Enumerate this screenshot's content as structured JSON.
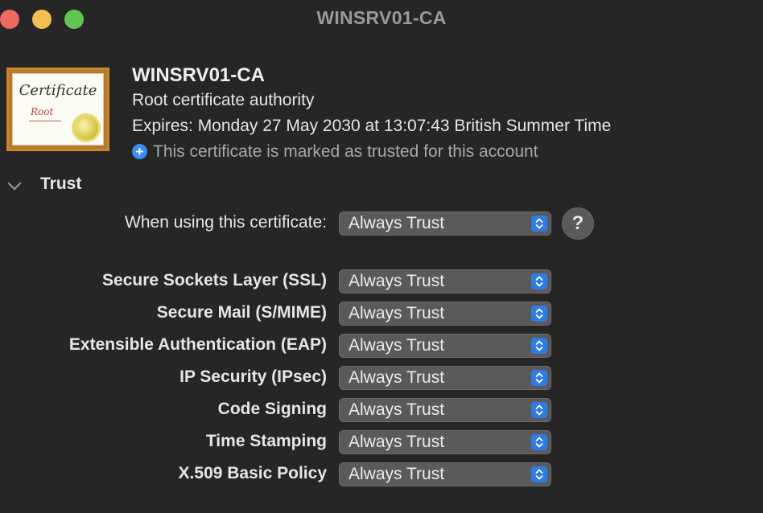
{
  "window": {
    "title": "WINSRV01-CA"
  },
  "certificate": {
    "name": "WINSRV01-CA",
    "kind": "Root certificate authority",
    "expiry": "Expires: Monday 27 May 2030 at 13:07:43 British Summer Time",
    "trust_status": "This certificate is marked as trusted for this account",
    "icon_word": "Certificate",
    "icon_sub": "Root"
  },
  "trust": {
    "section_title": "Trust",
    "when_using_label": "When using this certificate:",
    "when_using_value": "Always Trust",
    "help_label": "?",
    "rows": [
      {
        "label": "Secure Sockets Layer (SSL)",
        "value": "Always Trust"
      },
      {
        "label": "Secure Mail (S/MIME)",
        "value": "Always Trust"
      },
      {
        "label": "Extensible Authentication (EAP)",
        "value": "Always Trust"
      },
      {
        "label": "IP Security (IPsec)",
        "value": "Always Trust"
      },
      {
        "label": "Code Signing",
        "value": "Always Trust"
      },
      {
        "label": "Time Stamping",
        "value": "Always Trust"
      },
      {
        "label": "X.509 Basic Policy",
        "value": "Always Trust"
      }
    ]
  },
  "colors": {
    "accent": "#2e7ce6",
    "background": "#262626",
    "popup": "#5a5a5a"
  }
}
